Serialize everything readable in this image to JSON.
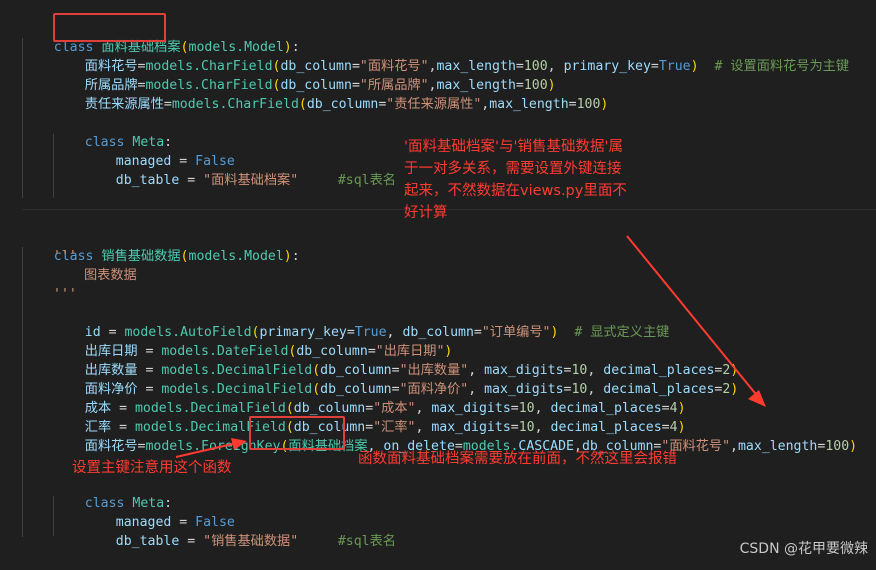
{
  "code": {
    "line1": {
      "kw": "class",
      "sp": " ",
      "name": "面料基础档案",
      "p1": "(",
      "base": "models.Model",
      "p2": ")",
      "colon": ":"
    },
    "line2": {
      "a": "面料花号",
      "eq": "=",
      "m": "models.",
      "cf": "CharField",
      "p": "(",
      "k1": "db_column",
      "e1": "=",
      "s1": "\"面料花号\"",
      "c1": ",",
      "k2": "max_length",
      "e2": "=",
      "n2": "100",
      "c2": ", ",
      "k3": "primary_key",
      "e3": "=",
      "v3": "True",
      "pe": ")",
      "cm": "  # 设置面料花号为主键"
    },
    "line3": {
      "a": "所属品牌",
      "eq": "=",
      "m": "models.",
      "cf": "CharField",
      "p": "(",
      "k1": "db_column",
      "e1": "=",
      "s1": "\"所属品牌\"",
      "c1": ",",
      "k2": "max_length",
      "e2": "=",
      "n2": "100",
      "pe": ")"
    },
    "line4": {
      "a": "责任来源属性",
      "eq": "=",
      "m": "models.",
      "cf": "CharField",
      "p": "(",
      "k1": "db_column",
      "e1": "=",
      "s1": "\"责任来源属性\"",
      "c1": ",",
      "k2": "max_length",
      "e2": "=",
      "n2": "100",
      "pe": ")"
    },
    "line5": {
      "kw": "class",
      "name": " Meta",
      "colon": ":"
    },
    "line6": {
      "a": "managed",
      "eq": " = ",
      "v": "False"
    },
    "line7": {
      "a": "db_table",
      "eq": " = ",
      "s": "\"面料基础档案\"",
      "cm": "     #sql表名"
    },
    "line8": {
      "kw": "class",
      "sp": " ",
      "name": "销售基础数据",
      "p1": "(",
      "base": "models.Model",
      "p2": ")",
      "colon": ":"
    },
    "line9": {
      "q": "'''"
    },
    "line10": {
      "t": "图表数据"
    },
    "line11": {
      "q": "'''"
    },
    "line12": {
      "a": "id",
      "eq": " = ",
      "m": "models.",
      "cf": "AutoField",
      "p": "(",
      "k1": "primary_key",
      "e1": "=",
      "v1": "True",
      "c1": ", ",
      "k2": "db_column",
      "e2": "=",
      "s2": "\"订单编号\"",
      "pe": ")",
      "cm": "  # 显式定义主键"
    },
    "line13": {
      "a": "出库日期",
      "eq": " = ",
      "m": "models.",
      "cf": "DateField",
      "p": "(",
      "k1": "db_column",
      "e1": "=",
      "s1": "\"出库日期\"",
      "pe": ")"
    },
    "line14": {
      "a": "出库数量",
      "eq": " = ",
      "m": "models.",
      "cf": "DecimalField",
      "p": "(",
      "k1": "db_column",
      "e1": "=",
      "s1": "\"出库数量\"",
      "c1": ", ",
      "k2": "max_digits",
      "e2": "=",
      "n2": "10",
      "c2": ", ",
      "k3": "decimal_places",
      "e3": "=",
      "n3": "2",
      "pe": ")"
    },
    "line15": {
      "a": "面料净价",
      "eq": " = ",
      "m": "models.",
      "cf": "DecimalField",
      "p": "(",
      "k1": "db_column",
      "e1": "=",
      "s1": "\"面料净价\"",
      "c1": ", ",
      "k2": "max_digits",
      "e2": "=",
      "n2": "10",
      "c2": ", ",
      "k3": "decimal_places",
      "e3": "=",
      "n3": "2",
      "pe": ")"
    },
    "line16": {
      "a": "成本",
      "eq": " = ",
      "m": "models.",
      "cf": "DecimalField",
      "p": "(",
      "k1": "db_column",
      "e1": "=",
      "s1": "\"成本\"",
      "c1": ", ",
      "k2": "max_digits",
      "e2": "=",
      "n2": "10",
      "c2": ", ",
      "k3": "decimal_places",
      "e3": "=",
      "n3": "4",
      "pe": ")"
    },
    "line17": {
      "a": "汇率",
      "eq": " = ",
      "m": "models.",
      "cf": "DecimalField",
      "p": "(",
      "k1": "db_column",
      "e1": "=",
      "s1": "\"汇率\"",
      "c1": ", ",
      "k2": "max_digits",
      "e2": "=",
      "n2": "10",
      "c2": ", ",
      "k3": "decimal_places",
      "e3": "=",
      "n3": "4",
      "pe": ")"
    },
    "line18": {
      "a": "面料花号",
      "eq": "=",
      "m": "models.",
      "cf": "ForeignKey",
      "p": "(",
      "ref": "面料基础档案",
      "c0": ", ",
      "k1": "on_delete",
      "e1": "=",
      "m2": "models.",
      "v1": "CASCADE",
      "c1": ",",
      "k2": "db_column",
      "e2": "=",
      "s2": "\"面料花号\"",
      "c2": ",",
      "k3": "max_length",
      "e3": "=",
      "n3": "100",
      "pe": ")"
    },
    "line19": {
      "kw": "class",
      "name": " Meta",
      "colon": ":"
    },
    "line20": {
      "a": "managed",
      "eq": " = ",
      "v": "False"
    },
    "line21": {
      "a": "db_table",
      "eq": " = ",
      "s": "\"销售基础数据\"",
      "cm": "     #sql表名"
    }
  },
  "annotations": {
    "note_top": [
      "'面料基础档案'与'销售基础数据'属",
      "于一对多关系，需要设置外键连接",
      "起来，不然数据在views.py里面不",
      "好计算"
    ],
    "note_left": "设置主键注意用这个函数",
    "note_right": "函数面料基础档案需要放在前面，不然这里会报错",
    "color": "#ff3b30"
  },
  "watermark": "CSDN @花甲要微辣"
}
